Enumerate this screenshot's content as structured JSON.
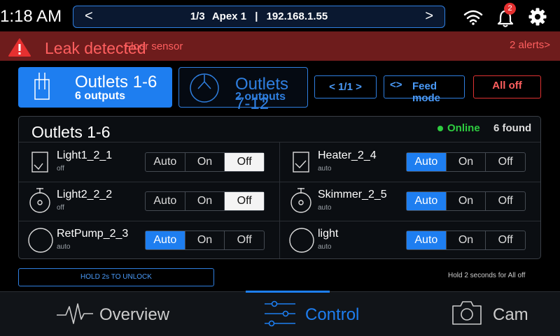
{
  "status_bar": {
    "time": "1:18 AM",
    "notification_count": "2"
  },
  "device_nav": {
    "prev": "<",
    "next": ">",
    "page": "1/3",
    "name": "Apex 1",
    "divider": "|",
    "ip": "192.168.1.55"
  },
  "alert": {
    "title": "Leak detected",
    "sensor": "Floor sensor",
    "count": "2 alerts>"
  },
  "groups": [
    {
      "title": "Outlets 1-6",
      "subtitle": "6 outputs",
      "selected": true
    },
    {
      "title": "Outlets 7-12",
      "subtitle": "2 outputs",
      "selected": false
    }
  ],
  "toolbar": {
    "page": "< 1/1 >",
    "feed_icon": "<>",
    "feed_label": "Feed mode",
    "all_off": "All off"
  },
  "panel": {
    "title": "Outlets 1-6",
    "status": "Online",
    "found": "6 found"
  },
  "mode_labels": [
    "Auto",
    "On",
    "Off"
  ],
  "outlets": [
    {
      "name": "Light1_2_1",
      "state": "off",
      "mode": "Off",
      "icon": "light-fixture-icon"
    },
    {
      "name": "Heater_2_4",
      "state": "auto",
      "mode": "Auto",
      "icon": "heater-icon"
    },
    {
      "name": "Light2_2_2",
      "state": "off",
      "mode": "Off",
      "icon": "pendant-light-icon"
    },
    {
      "name": "Skimmer_2_5",
      "state": "auto",
      "mode": "Auto",
      "icon": "pendant-light-icon"
    },
    {
      "name": "RetPump_2_3",
      "state": "auto",
      "mode": "Auto",
      "icon": "pump-icon"
    },
    {
      "name": "light",
      "state": "auto",
      "mode": "Auto",
      "icon": "pump-icon"
    }
  ],
  "footer": {
    "hold_unlock": "HOLD 2s TO UNLOCK",
    "hold_note": "Hold 2 seconds for All off"
  },
  "nav": {
    "overview": "Overview",
    "control": "Control",
    "cam": "Cam"
  },
  "colors": {
    "accent": "#1e7ef0",
    "alert_bg": "#6e1c1c",
    "alert_text": "#ff5f5f",
    "online": "#2ecc40"
  }
}
